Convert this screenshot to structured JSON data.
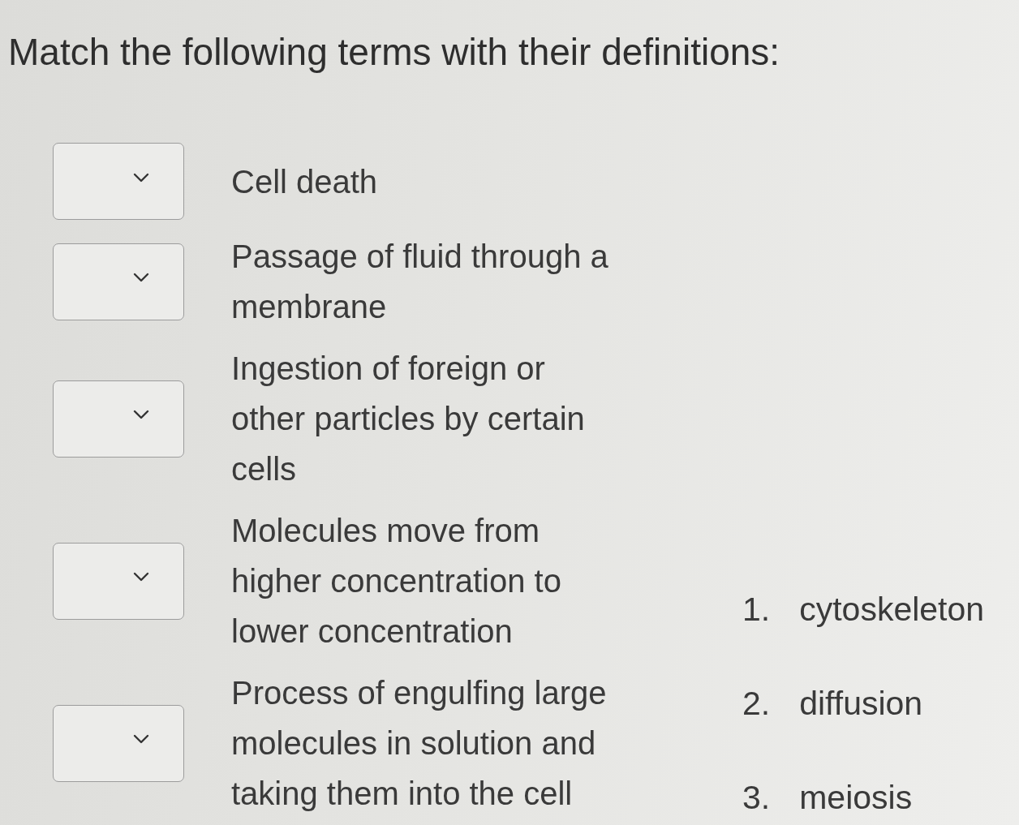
{
  "question": {
    "prompt": "Match the following terms with their definitions:"
  },
  "items": [
    {
      "definition": "Cell death"
    },
    {
      "definition": "Passage of fluid through a membrane"
    },
    {
      "definition": "Ingestion of foreign or other particles by certain cells"
    },
    {
      "definition": "Molecules move from higher concentration to lower concentration"
    },
    {
      "definition": "Process of engulfing large molecules in solution and taking them into the cell"
    }
  ],
  "options": [
    {
      "number": "1.",
      "term": "cytoskeleton"
    },
    {
      "number": "2.",
      "term": "diffusion"
    },
    {
      "number": "3.",
      "term": "meiosis"
    }
  ]
}
